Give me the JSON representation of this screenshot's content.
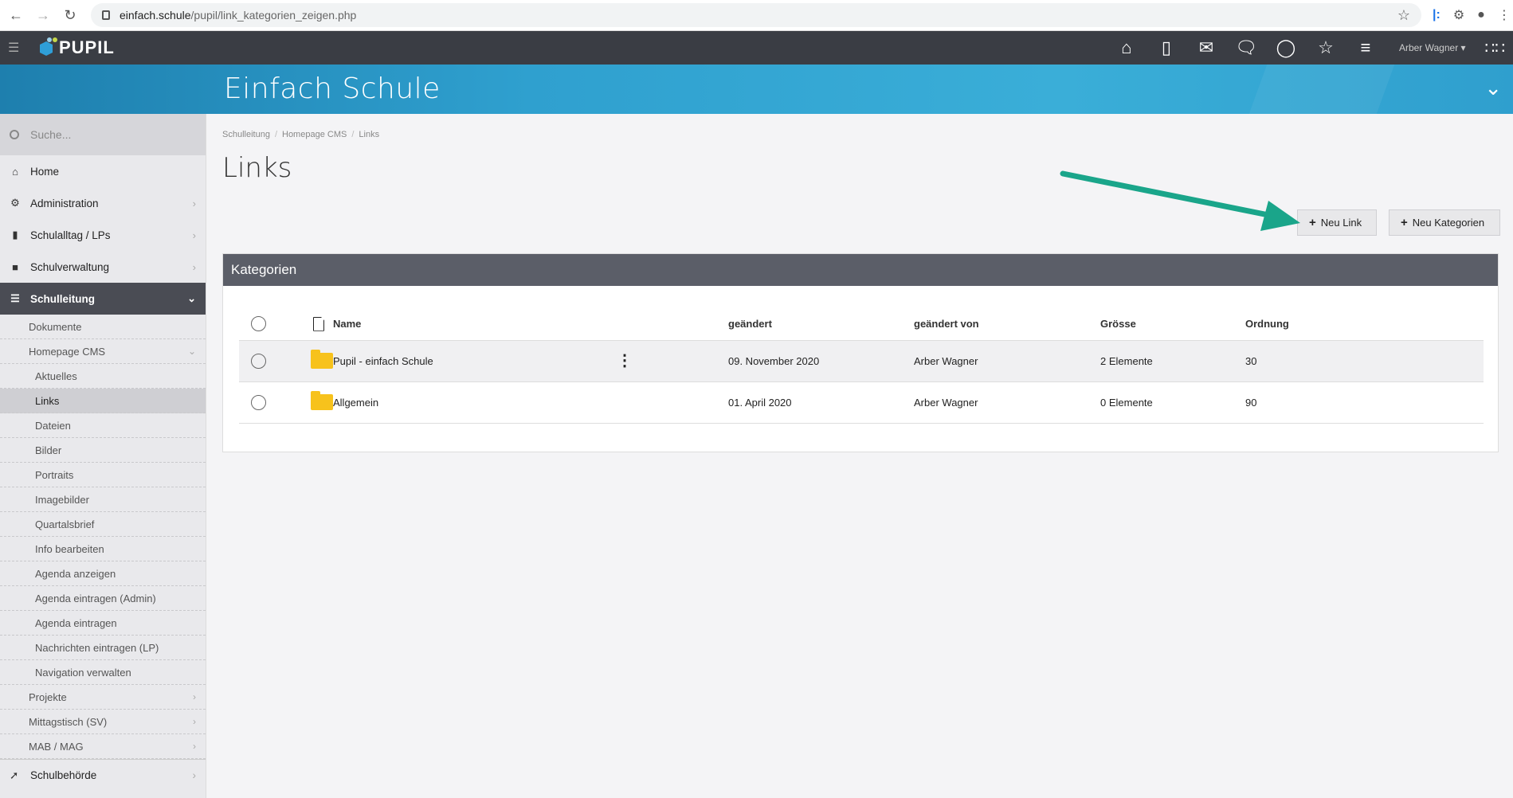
{
  "browser": {
    "url_host": "einfach.schule",
    "url_path": "/pupil/link_kategorien_zeigen.php"
  },
  "app": {
    "logo_text": "PUPIL",
    "user_name": "Arber Wagner",
    "top_icons": [
      "home-icon",
      "office-icon",
      "outlook-icon",
      "chat-icon",
      "lightbulb-icon",
      "star-icon",
      "sliders-icon"
    ]
  },
  "banner": {
    "title": "Einfach Schule"
  },
  "sidebar": {
    "search_placeholder": "Suche...",
    "items": [
      {
        "label": "Home",
        "icon": "home-icon"
      },
      {
        "label": "Administration",
        "icon": "cogs-icon"
      },
      {
        "label": "Schulalltag / LPs",
        "icon": "bookmark-icon"
      },
      {
        "label": "Schulverwaltung",
        "icon": "folder-open-icon"
      },
      {
        "label": "Schulleitung",
        "icon": "signpost-icon"
      }
    ],
    "sub_items": [
      {
        "label": "Dokumente"
      },
      {
        "label": "Homepage CMS"
      }
    ],
    "cms_items": [
      {
        "label": "Aktuelles"
      },
      {
        "label": "Links"
      },
      {
        "label": "Dateien"
      },
      {
        "label": "Bilder"
      },
      {
        "label": "Portraits"
      },
      {
        "label": "Imagebilder"
      },
      {
        "label": "Quartalsbrief"
      },
      {
        "label": "Info bearbeiten"
      },
      {
        "label": "Agenda anzeigen"
      },
      {
        "label": "Agenda eintragen (Admin)"
      },
      {
        "label": "Agenda eintragen"
      },
      {
        "label": "Nachrichten eintragen (LP)"
      },
      {
        "label": "Navigation verwalten"
      }
    ],
    "more_items": [
      {
        "label": "Projekte"
      },
      {
        "label": "Mittagstisch (SV)"
      },
      {
        "label": "MAB / MAG"
      }
    ],
    "bottom_item": {
      "label": "Schulbehörde",
      "icon": "location-arrow-icon"
    }
  },
  "main": {
    "breadcrumb": [
      "Schulleitung",
      "Homepage CMS",
      "Links"
    ],
    "title": "Links",
    "btn_new_link": "Neu Link",
    "btn_new_category": "Neu Kategorien",
    "panel_title": "Kategorien",
    "columns": [
      "Name",
      "geändert",
      "geändert von",
      "Grösse",
      "Ordnung"
    ],
    "rows": [
      {
        "name": "Pupil - einfach Schule",
        "changed": "09. November 2020",
        "changed_by": "Arber Wagner",
        "size": "2 Elemente",
        "order": "30"
      },
      {
        "name": "Allgemein",
        "changed": "01. April 2020",
        "changed_by": "Arber Wagner",
        "size": "0 Elemente",
        "order": "90"
      }
    ]
  },
  "colors": {
    "topbar": "#3a3d44",
    "banner": "#2fa0cf",
    "panel_header": "#5b5e68",
    "folder": "#f7c21c",
    "arrow": "#1aa58a"
  }
}
